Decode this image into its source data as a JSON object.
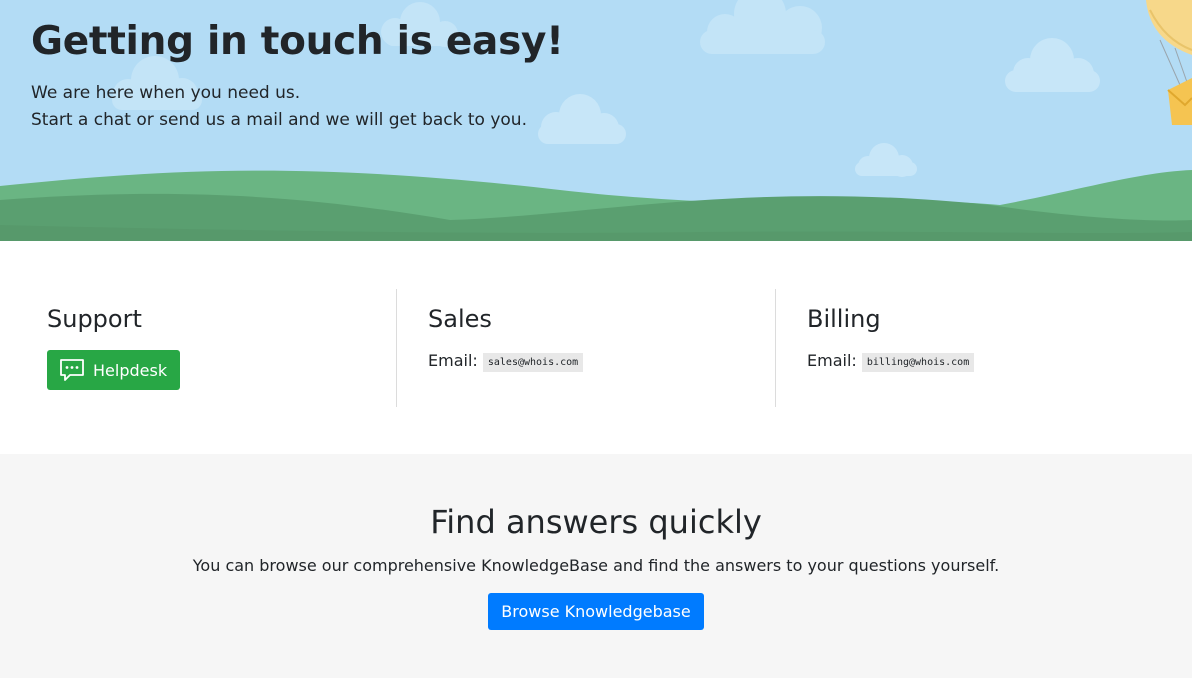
{
  "hero": {
    "title": "Getting in touch is easy!",
    "subtitle_line1": "We are here when you need us.",
    "subtitle_line2": "Start a chat or send us a mail and we will get back to you."
  },
  "support": {
    "heading": "Support",
    "helpdesk_label": "Helpdesk",
    "helpdesk_icon": "chat-bubble-icon"
  },
  "sales": {
    "heading": "Sales",
    "email_label": "Email:",
    "email": "sales@whois.com"
  },
  "billing": {
    "heading": "Billing",
    "email_label": "Email:",
    "email": "billing@whois.com"
  },
  "knowledgebase": {
    "heading": "Find answers quickly",
    "description": "You can browse our comprehensive KnowledgeBase and find the answers to your questions yourself.",
    "button_label": "Browse Knowledgebase"
  },
  "colors": {
    "sky": "#b3dcf5",
    "hills": "#5fa676",
    "helpdesk_button": "#28a745",
    "kb_button": "#007bff",
    "kb_background": "#f6f6f6"
  }
}
